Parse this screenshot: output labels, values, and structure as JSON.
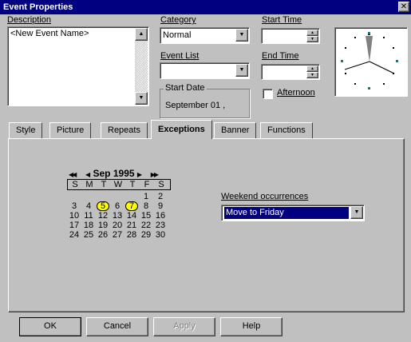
{
  "window": {
    "title": "Event Properties",
    "close_glyph": "✕"
  },
  "description": {
    "label": "Description",
    "value": "<New Event Name>"
  },
  "category": {
    "label": "Category",
    "value": "Normal"
  },
  "event_list": {
    "label": "Event List",
    "value": ""
  },
  "start_date": {
    "label": "Start Date",
    "value": "September  01 ,"
  },
  "start_time": {
    "label": "Start Time",
    "value": ""
  },
  "end_time": {
    "label": "End Time",
    "value": ""
  },
  "afternoon": {
    "label": "Afternoon",
    "checked": false
  },
  "tabs": [
    {
      "label": "Style"
    },
    {
      "label": "Picture"
    },
    {
      "label": "Repeats"
    },
    {
      "label": "Exceptions"
    },
    {
      "label": "Banner"
    },
    {
      "label": "Functions"
    }
  ],
  "calendar": {
    "nav_prev_year": "◀◀",
    "nav_prev_month": "◀",
    "month_year": "Sep 1995",
    "nav_next_month": "▶",
    "nav_next_year": "▶▶",
    "weekdays": [
      "S",
      "M",
      "T",
      "W",
      "T",
      "F",
      "S"
    ],
    "weeks": [
      [
        "",
        "",
        "",
        "",
        "",
        "1",
        "2"
      ],
      [
        "3",
        "4",
        "5",
        "6",
        "7",
        "8",
        "9"
      ],
      [
        "10",
        "11",
        "12",
        "13",
        "14",
        "15",
        "16"
      ],
      [
        "17",
        "18",
        "19",
        "20",
        "21",
        "22",
        "23"
      ],
      [
        "24",
        "25",
        "26",
        "27",
        "28",
        "29",
        "30"
      ]
    ],
    "highlighted": [
      "5",
      "7"
    ],
    "highlight_color": "#ffff00"
  },
  "weekend": {
    "label": "Weekend occurrences",
    "value": "Move to Friday",
    "selection_color": "#000080"
  },
  "buttons": {
    "ok": "OK",
    "cancel": "Cancel",
    "apply": "Apply",
    "help": "Help"
  },
  "colors": {
    "titlebar": "#000080",
    "face": "#c0c0c0"
  }
}
